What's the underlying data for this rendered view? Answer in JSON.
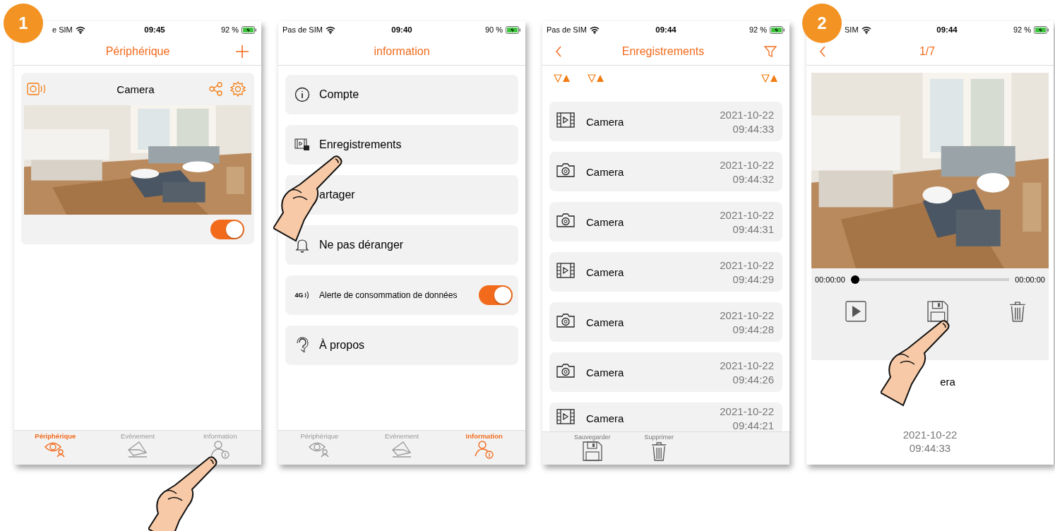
{
  "screens": [
    {
      "kind": "devices",
      "badge": "1",
      "pointer": true,
      "status": {
        "carrier": "e SIM",
        "time": "09:45",
        "battery": "92 %"
      },
      "title": "Périphérique",
      "card": {
        "name": "Camera",
        "switch_on": true
      },
      "tabs": [
        {
          "kind": "device",
          "label": "Périphérique",
          "selected": true
        },
        {
          "kind": "event",
          "label": "Evènement",
          "selected": false
        },
        {
          "kind": "info",
          "label": "Information",
          "selected": false
        }
      ]
    },
    {
      "kind": "info",
      "pointer": true,
      "status": {
        "carrier": "Pas de SIM",
        "time": "09:40",
        "battery": "90 %"
      },
      "title": "information",
      "menu": [
        {
          "kind": "info",
          "label": "Compte"
        },
        {
          "kind": "recordings",
          "label": "Enregistrements"
        },
        {
          "kind": "share",
          "label": "artager"
        },
        {
          "kind": "bell",
          "label": "Ne pas déranger"
        },
        {
          "kind": "data",
          "tag": "4G",
          "label": "Alerte de consommation de données",
          "on": true
        },
        {
          "kind": "help",
          "label": "À propos"
        }
      ],
      "tabs": [
        {
          "kind": "device",
          "label": "Périphérique",
          "selected": false
        },
        {
          "kind": "event",
          "label": "Evènement",
          "selected": false
        },
        {
          "kind": "info",
          "label": "Information",
          "selected": true
        }
      ]
    },
    {
      "kind": "recordings",
      "status": {
        "carrier": "Pas de SIM",
        "time": "09:44",
        "battery": "92 %"
      },
      "title": "Enregistrements",
      "rows": [
        {
          "kind": "video",
          "name": "Camera",
          "date": "2021-10-22",
          "time": "09:44:33"
        },
        {
          "name": "Camera",
          "date": "2021-10-22",
          "time": "09:44:32"
        },
        {
          "name": "Camera",
          "date": "2021-10-22",
          "time": "09:44:31"
        },
        {
          "kind": "video",
          "name": "Camera",
          "date": "2021-10-22",
          "time": "09:44:29"
        },
        {
          "name": "Camera",
          "date": "2021-10-22",
          "time": "09:44:28"
        },
        {
          "name": "Camera",
          "date": "2021-10-22",
          "time": "09:44:26"
        },
        {
          "kind": "video",
          "name": "Camera",
          "date": "2021-10-22",
          "time": "09:44:21"
        }
      ],
      "actions": [
        {
          "kind": "save",
          "label": "Sauvegarder"
        },
        {
          "kind": "delete",
          "label": "Supprimer"
        }
      ]
    },
    {
      "kind": "viewer",
      "badge": "2",
      "pointer": true,
      "status": {
        "carrier": "SIM",
        "time": "09:44",
        "battery": "92 %"
      },
      "title": "1/7",
      "player": {
        "start": "00:00:00",
        "end": "00:00:00",
        "level": 0
      },
      "name": "era",
      "date": "2021-10-22",
      "time": "09:44:33"
    }
  ]
}
